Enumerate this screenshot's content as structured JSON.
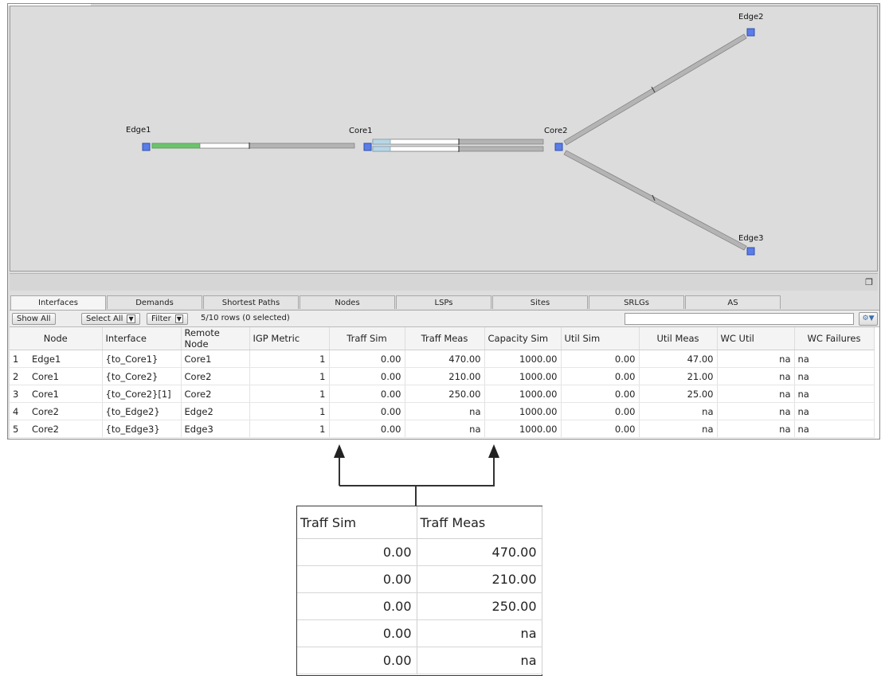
{
  "topology": {
    "nodes": [
      {
        "id": "edge1",
        "label": "Edge1"
      },
      {
        "id": "core1",
        "label": "Core1"
      },
      {
        "id": "core2",
        "label": "Core2"
      },
      {
        "id": "edge2",
        "label": "Edge2"
      },
      {
        "id": "edge3",
        "label": "Edge3"
      }
    ],
    "colors": {
      "node": "#5b7de8",
      "link": "#a9a9a9",
      "util_green": "#6cc36c",
      "util_blue": "#b7d6e6",
      "canvas": "#dcdcdc"
    }
  },
  "tabs": [
    "Interfaces",
    "Demands",
    "Shortest Paths",
    "Nodes",
    "LSPs",
    "Sites",
    "SRLGs",
    "AS"
  ],
  "active_tab": "Interfaces",
  "toolbar": {
    "show_all": "Show All",
    "select_all": "Select All",
    "filter": "Filter",
    "row_count": "5/10 rows (0 selected)"
  },
  "table": {
    "columns": [
      "Node",
      "Interface",
      "Remote Node",
      "IGP Metric",
      "Traff Sim",
      "Traff Meas",
      "Capacity Sim",
      "Util Sim",
      "Util Meas",
      "WC Util",
      "WC Failures"
    ],
    "rows": [
      [
        "1",
        "Edge1",
        "{to_Core1}",
        "Core1",
        "1",
        "0.00",
        "470.00",
        "1000.00",
        "0.00",
        "47.00",
        "na",
        "na"
      ],
      [
        "2",
        "Core1",
        "{to_Core2}",
        "Core2",
        "1",
        "0.00",
        "210.00",
        "1000.00",
        "0.00",
        "21.00",
        "na",
        "na"
      ],
      [
        "3",
        "Core1",
        "{to_Core2}[1]",
        "Core2",
        "1",
        "0.00",
        "250.00",
        "1000.00",
        "0.00",
        "25.00",
        "na",
        "na"
      ],
      [
        "4",
        "Core2",
        "{to_Edge2}",
        "Edge2",
        "1",
        "0.00",
        "na",
        "1000.00",
        "0.00",
        "na",
        "na",
        "na"
      ],
      [
        "5",
        "Core2",
        "{to_Edge3}",
        "Edge3",
        "1",
        "0.00",
        "na",
        "1000.00",
        "0.00",
        "na",
        "na",
        "na"
      ]
    ]
  },
  "callout": {
    "columns": [
      "Traff Sim",
      "Traff Meas"
    ],
    "rows": [
      [
        "0.00",
        "470.00"
      ],
      [
        "0.00",
        "210.00"
      ],
      [
        "0.00",
        "250.00"
      ],
      [
        "0.00",
        "na"
      ],
      [
        "0.00",
        "na"
      ]
    ]
  }
}
